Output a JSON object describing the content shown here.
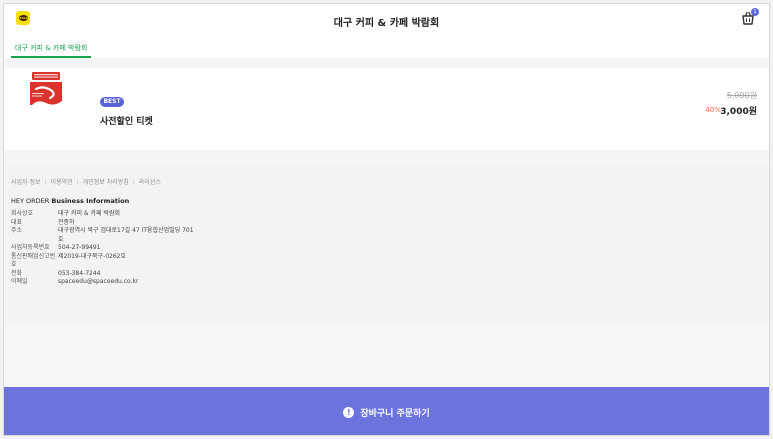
{
  "header": {
    "title": "대구 커피 & 카페 박람회",
    "logo_icon": "kakaotalk-logo-icon",
    "logo_text": "TALK",
    "cart_icon": "basket-icon",
    "cart_count": "1"
  },
  "tabs": [
    {
      "label": "대구 커피 & 카페 박람회",
      "active": true
    }
  ],
  "product": {
    "badge": "BEST",
    "name": "사전할인 티켓",
    "original_price": "5,000원",
    "discount": "40%",
    "price": "3,000원",
    "thumb_color": "#d9342b"
  },
  "footer": {
    "links": [
      "사업자 정보",
      "이용약관",
      "개인정보 처리방침",
      "라이선스"
    ],
    "brand_prefix": "HEY ORDER",
    "brand_suffix": "Business Information",
    "info": [
      {
        "key": "회사상호",
        "value": "대구 커피 & 카페 박람회"
      },
      {
        "key": "대표",
        "value": "전종하"
      },
      {
        "key": "주소",
        "value": "대구광역시 북구 검대로17길 47 IT융합산업빌딩 701호"
      },
      {
        "key": "사업자등록번호",
        "value": "504-27-99491"
      },
      {
        "key": "통신판매업신고번호",
        "value": "제2019-대구북구-0262호"
      },
      {
        "key": "전화",
        "value": "053-384-7244"
      },
      {
        "key": "이메일",
        "value": "spaceedu@spaceedu.co.kr"
      }
    ]
  },
  "order_button": {
    "icon": "info-circle-icon",
    "label": "장바구니 주문하기"
  },
  "colors": {
    "accent": "#6b73dc",
    "tab_active": "#18a34a",
    "discount": "#f06a4a",
    "badge": "#5b61d6"
  }
}
